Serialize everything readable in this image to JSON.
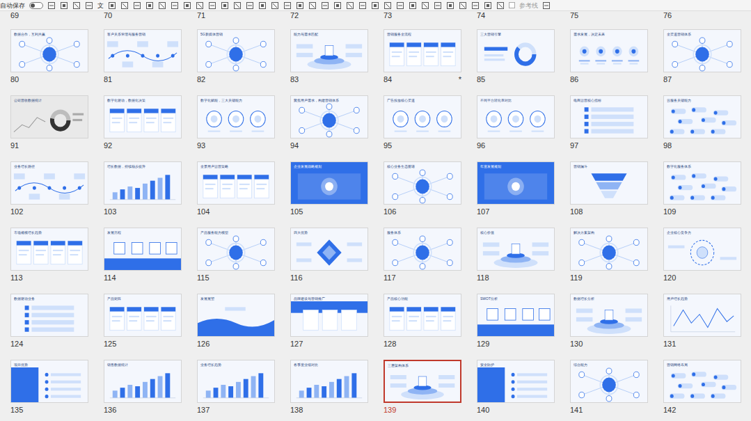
{
  "toolbar": {
    "autosave_label": "自动保存",
    "autosave_on": false,
    "text_button": "文",
    "guides_label": "参考线",
    "guides_checked": false
  },
  "top_row": [
    "69",
    "70",
    "71",
    "72",
    "73",
    "74",
    "75",
    "76"
  ],
  "slides": [
    {
      "number": "80",
      "title": "数据合作，互利共赢",
      "kind": "hub",
      "selected": false,
      "mark": ""
    },
    {
      "number": "81",
      "title": "客户关系管理与服务营销",
      "kind": "timeline",
      "selected": false,
      "mark": ""
    },
    {
      "number": "82",
      "title": "5G新媒体营销",
      "kind": "hub",
      "selected": false,
      "mark": ""
    },
    {
      "number": "83",
      "title": "能力与需求匹配",
      "kind": "podium",
      "selected": false,
      "mark": ""
    },
    {
      "number": "84",
      "title": "营销服务全流程",
      "kind": "cards",
      "selected": false,
      "mark": "*"
    },
    {
      "number": "85",
      "title": "三大营销引擎",
      "kind": "donut",
      "selected": false,
      "mark": ""
    },
    {
      "number": "86",
      "title": "需求发展，决定未来",
      "kind": "icons",
      "selected": false,
      "mark": ""
    },
    {
      "number": "87",
      "title": "全渠道营销体系",
      "kind": "hub",
      "selected": false,
      "mark": ""
    },
    {
      "number": "91",
      "title": "公司营收数据统计",
      "kind": "gray",
      "selected": false,
      "mark": ""
    },
    {
      "number": "92",
      "title": "数字化驱动，数据化决策",
      "kind": "cards",
      "selected": false,
      "mark": ""
    },
    {
      "number": "93",
      "title": "数字化赋能，三大关键能力",
      "kind": "circles",
      "selected": false,
      "mark": ""
    },
    {
      "number": "94",
      "title": "聚焦用户需求，构建营销体系",
      "kind": "hub",
      "selected": false,
      "mark": ""
    },
    {
      "number": "95",
      "title": "广告投放核心渠道",
      "kind": "circles",
      "selected": false,
      "mark": ""
    },
    {
      "number": "96",
      "title": "不同平台转化率对比",
      "kind": "circles",
      "selected": false,
      "mark": ""
    },
    {
      "number": "97",
      "title": "电商运营核心指标",
      "kind": "list",
      "selected": false,
      "mark": ""
    },
    {
      "number": "98",
      "title": "云服务关键能力",
      "kind": "nodes",
      "selected": false,
      "mark": ""
    },
    {
      "number": "102",
      "title": "业务增长路径",
      "kind": "timeline",
      "selected": false,
      "mark": ""
    },
    {
      "number": "103",
      "title": "增长数据，持续稳步提升",
      "kind": "bars",
      "selected": false,
      "mark": ""
    },
    {
      "number": "104",
      "title": "全景用户运营策略",
      "kind": "cards",
      "selected": false,
      "mark": ""
    },
    {
      "number": "105",
      "title": "企业发展战略规划",
      "kind": "blue",
      "selected": false,
      "mark": ""
    },
    {
      "number": "106",
      "title": "核心业务生态图谱",
      "kind": "hub",
      "selected": false,
      "mark": ""
    },
    {
      "number": "107",
      "title": "年度发展规划",
      "kind": "blue",
      "selected": false,
      "mark": ""
    },
    {
      "number": "108",
      "title": "营销漏斗",
      "kind": "funnel",
      "selected": false,
      "mark": ""
    },
    {
      "number": "109",
      "title": "数字化服务体系",
      "kind": "nodes",
      "selected": false,
      "mark": ""
    },
    {
      "number": "113",
      "title": "市场规模增长趋势",
      "kind": "cards",
      "selected": false,
      "mark": ""
    },
    {
      "number": "114",
      "title": "发展历程",
      "kind": "bottomblue",
      "selected": false,
      "mark": ""
    },
    {
      "number": "115",
      "title": "产品服务能力模型",
      "kind": "hub",
      "selected": false,
      "mark": ""
    },
    {
      "number": "116",
      "title": "四大优势",
      "kind": "diamond",
      "selected": false,
      "mark": ""
    },
    {
      "number": "117",
      "title": "服务体系",
      "kind": "hub",
      "selected": false,
      "mark": ""
    },
    {
      "number": "118",
      "title": "核心价值",
      "kind": "podium",
      "selected": false,
      "mark": ""
    },
    {
      "number": "119",
      "title": "解决方案架构",
      "kind": "hub",
      "selected": false,
      "mark": ""
    },
    {
      "number": "120",
      "title": "企业核心竞争力",
      "kind": "ring",
      "selected": false,
      "mark": ""
    },
    {
      "number": "124",
      "title": "数据驱动业务",
      "kind": "list",
      "selected": false,
      "mark": ""
    },
    {
      "number": "125",
      "title": "产品矩阵",
      "kind": "cards",
      "selected": false,
      "mark": ""
    },
    {
      "number": "126",
      "title": "发展展望",
      "kind": "wave",
      "selected": false,
      "mark": ""
    },
    {
      "number": "127",
      "title": "品牌建设与营销推广",
      "kind": "bluetop",
      "selected": false,
      "mark": ""
    },
    {
      "number": "128",
      "title": "产品核心功能",
      "kind": "cards",
      "selected": false,
      "mark": ""
    },
    {
      "number": "129",
      "title": "SWOT分析",
      "kind": "bottomblue",
      "selected": false,
      "mark": ""
    },
    {
      "number": "130",
      "title": "数据增长分析",
      "kind": "podium",
      "selected": false,
      "mark": ""
    },
    {
      "number": "131",
      "title": "用户增长趋势",
      "kind": "line",
      "selected": false,
      "mark": ""
    },
    {
      "number": "135",
      "title": "项目优势",
      "kind": "leftblue",
      "selected": false,
      "mark": ""
    },
    {
      "number": "136",
      "title": "销售数据统计",
      "kind": "bars",
      "selected": false,
      "mark": ""
    },
    {
      "number": "137",
      "title": "业务增长趋势",
      "kind": "bars",
      "selected": false,
      "mark": ""
    },
    {
      "number": "138",
      "title": "各季度业绩对比",
      "kind": "bars",
      "selected": false,
      "mark": ""
    },
    {
      "number": "139",
      "title": "三层架构体系",
      "kind": "podium",
      "selected": true,
      "mark": ""
    },
    {
      "number": "140",
      "title": "安全防护",
      "kind": "leftblue",
      "selected": false,
      "mark": ""
    },
    {
      "number": "141",
      "title": "综合能力",
      "kind": "hub",
      "selected": false,
      "mark": ""
    },
    {
      "number": "142",
      "title": "营销网络布局",
      "kind": "nodes",
      "selected": false,
      "mark": ""
    }
  ]
}
